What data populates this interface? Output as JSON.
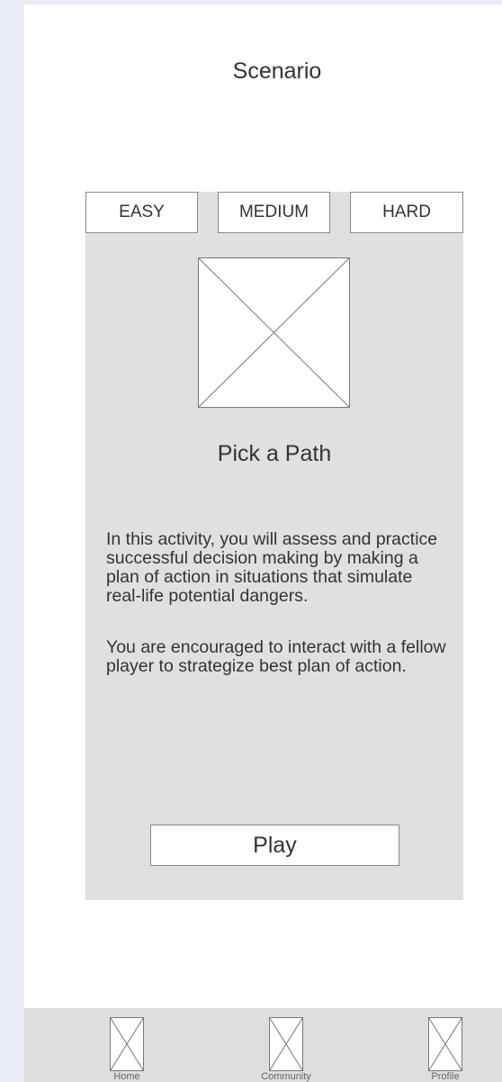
{
  "header": {
    "title": "Scenario"
  },
  "difficulty_tabs": [
    {
      "label": "EASY"
    },
    {
      "label": "MEDIUM"
    },
    {
      "label": "HARD"
    }
  ],
  "card": {
    "title": "Pick a Path",
    "description": [
      "In this activity, you will assess and practice successful decision making by making a plan of action in situations that simulate real-life potential dangers.",
      "You are encouraged to interact with a fellow player to strategize best plan of action."
    ],
    "play_label": "Play"
  },
  "bottom_nav": {
    "items": [
      {
        "label": "Home",
        "icon": "image-placeholder-icon"
      },
      {
        "label": "Community",
        "icon": "image-placeholder-icon"
      },
      {
        "label": "Profile",
        "icon": "image-placeholder-icon"
      }
    ]
  }
}
